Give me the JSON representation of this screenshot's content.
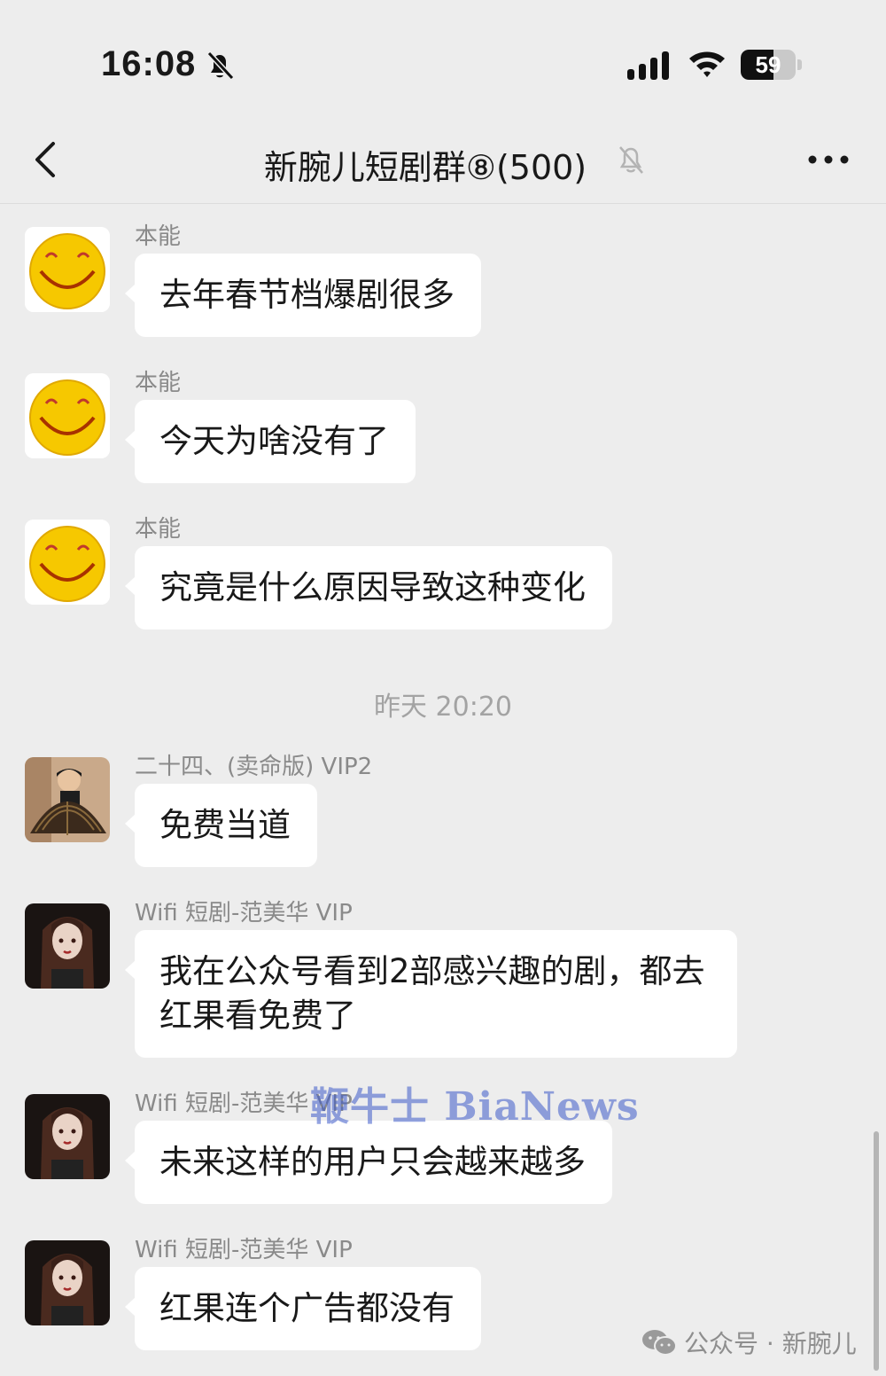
{
  "status_bar": {
    "time": "16:08",
    "battery": "59",
    "battery_level": 0.59,
    "icons": [
      "bell-slash-icon",
      "cellular-signal-icon",
      "wifi-icon",
      "battery-icon"
    ]
  },
  "nav": {
    "title": "新腕儿短剧群⑧(500)",
    "icons": [
      "back-chevron-icon",
      "mute-bell-icon",
      "more-dots-icon"
    ]
  },
  "messages": [
    {
      "sender": "本能",
      "text": "去年春节档爆剧很多",
      "avatar": "smiley-avatar"
    },
    {
      "sender": "本能",
      "text": "今天为啥没有了",
      "avatar": "smiley-avatar"
    },
    {
      "sender": "本能",
      "text": "究竟是什么原因导致这种变化",
      "avatar": "smiley-avatar"
    },
    {
      "sender": "二十四、(卖命版) VIP2",
      "text": "免费当道",
      "avatar": "man-with-fan-avatar"
    },
    {
      "sender": "Wifi 短剧-范美华 VIP",
      "text": "我在公众号看到2部感兴趣的剧，都去红果看免费了",
      "avatar": "woman-portrait-avatar"
    },
    {
      "sender": "Wifi 短剧-范美华 VIP",
      "text": "未来这样的用户只会越来越多",
      "avatar": "woman-portrait-avatar"
    },
    {
      "sender": "Wifi 短剧-范美华 VIP",
      "text": "红果连个广告都没有",
      "avatar": "woman-portrait-avatar"
    }
  ],
  "time_separator": "昨天 20:20",
  "watermark": "鞭牛士 BiaNews",
  "footer": {
    "text": "公众号 · 新腕儿",
    "icon": "wechat-icon"
  },
  "colors": {
    "background": "#ededed",
    "bubble": "#ffffff",
    "meta_text": "#8a8a8a"
  }
}
